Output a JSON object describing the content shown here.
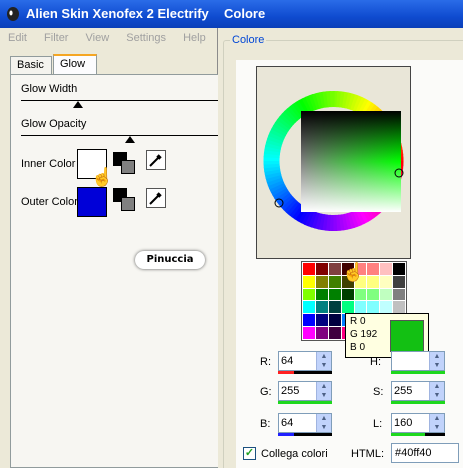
{
  "left_window": {
    "title": "Alien Skin Xenofex 2 Electrify",
    "menu": [
      "Edit",
      "Filter",
      "View",
      "Settings",
      "Help"
    ],
    "tabs": [
      "Basic",
      "Glow"
    ],
    "glow_width_label": "Glow Width",
    "glow_opacity_label": "Glow Opacity",
    "inner_color_label": "Inner Color",
    "outer_color_label": "Outer Color",
    "inner_color": "#ffffff",
    "outer_color": "#0000d8",
    "watermark": "Pinuccia"
  },
  "right_window": {
    "title": "Colore",
    "group_label": "Colore",
    "tooltip": {
      "r": "R 0",
      "g": "G 192",
      "b": "B 0",
      "color": "#00c000"
    },
    "fields": {
      "r_label": "R:",
      "r_value": "64",
      "g_label": "G:",
      "g_value": "255",
      "b_label": "B:",
      "b_value": "64",
      "h_label": "H:",
      "h_value": "",
      "s_label": "S:",
      "s_value": "255",
      "l_label": "L:",
      "l_value": "160"
    },
    "link_colors_label": "Collega colori",
    "link_colors_checked": true,
    "html_label": "HTML:",
    "html_value": "#40ff40"
  },
  "palette_colors": [
    "#ff0000",
    "#800000",
    "#804040",
    "#400000",
    "#ff8080",
    "#ff8080",
    "#ffc0c0",
    "#000000",
    "#ffff00",
    "#808000",
    "#408000",
    "#404000",
    "#ffff80",
    "#ffff80",
    "#ffffc0",
    "#404040",
    "#80ff00",
    "#008000",
    "#008000",
    "#004000",
    "#80ff80",
    "#80ff80",
    "#c0ffc0",
    "#808080",
    "#00ffff",
    "#008080",
    "#004040",
    "#00ff80",
    "#80ffff",
    "#80ffff",
    "#c0ffff",
    "#c0c0c0",
    "#0000ff",
    "#000080",
    "#000040",
    "#0080ff",
    "#8080ff",
    "#8080ff",
    "#c0c0ff",
    "#ffffff",
    "#ff00ff",
    "#800080",
    "#400040",
    "#ff0080",
    "#ff80ff",
    "#ff80ff",
    "#ffc0ff",
    "#ffffff"
  ]
}
